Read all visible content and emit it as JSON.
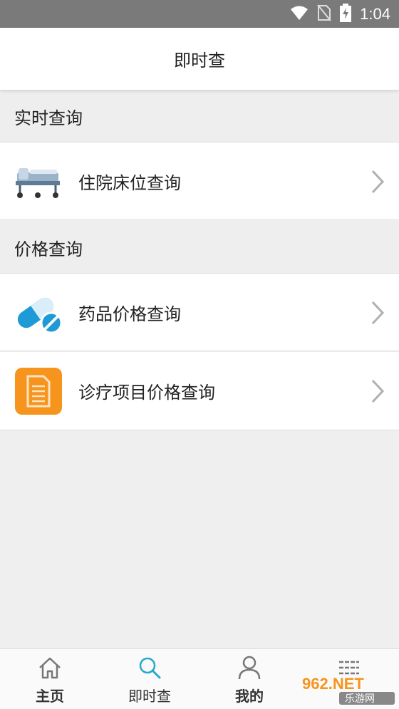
{
  "status_bar": {
    "time": "1:04",
    "icons": [
      "wifi-icon",
      "no-sim-icon",
      "battery-charging-icon"
    ]
  },
  "header": {
    "title": "即时查"
  },
  "sections": [
    {
      "title": "实时查询",
      "items": [
        {
          "label": "住院床位查询",
          "icon": "hospital-bed-icon"
        }
      ]
    },
    {
      "title": "价格查询",
      "items": [
        {
          "label": "药品价格查询",
          "icon": "pill-icon"
        },
        {
          "label": "诊疗项目价格查询",
          "icon": "document-icon"
        }
      ]
    }
  ],
  "bottom_nav": {
    "items": [
      {
        "label": "主页",
        "icon": "home-icon"
      },
      {
        "label": "即时查",
        "icon": "search-icon"
      },
      {
        "label": "我的",
        "icon": "user-icon"
      },
      {
        "label": "",
        "icon": "menu-icon"
      }
    ],
    "active_index": 1
  },
  "watermark": {
    "text": "962.NET",
    "subtext": "乐游网"
  },
  "colors": {
    "status_bar": "#7a7a7a",
    "accent": "#26a9c9",
    "doc_orange": "#f7941d",
    "pill_blue": "#1e9ad6"
  }
}
